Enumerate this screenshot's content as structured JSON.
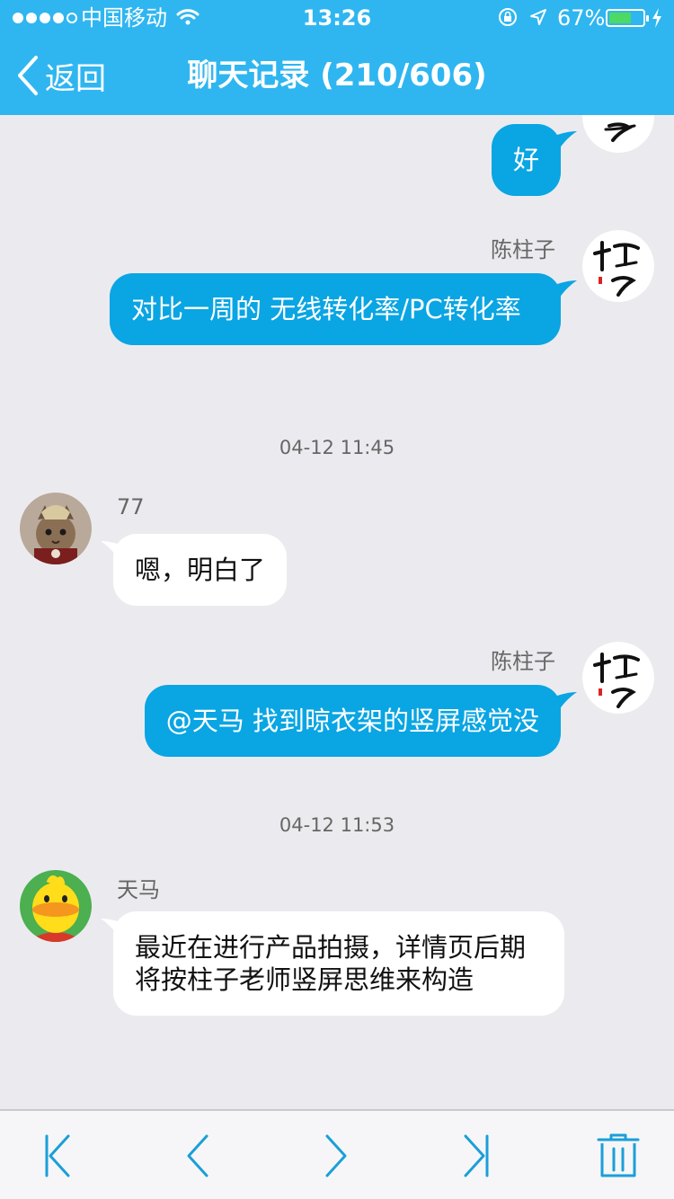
{
  "status_bar": {
    "carrier": "中国移动",
    "time": "13:26",
    "battery_percent": "67%",
    "battery_level": 0.67,
    "signal_bars_filled": 4,
    "signal_bars_total": 5
  },
  "nav": {
    "back_label": "返回",
    "title": "聊天记录 (210/606)"
  },
  "messages": [
    {
      "direction": "out",
      "sender": "",
      "text": "好",
      "avatar_icon": "calligraphy-avatar-icon"
    },
    {
      "direction": "out",
      "sender": "陈柱子",
      "text": "对比一周的  无线转化率/PC转化率",
      "avatar_icon": "calligraphy-avatar-icon"
    },
    {
      "direction": "in",
      "sender": "77",
      "text": "嗯，明白了",
      "avatar_icon": "cat-warrior-avatar-icon"
    },
    {
      "direction": "out",
      "sender": "陈柱子",
      "text": "@天马 找到晾衣架的竖屏感觉没",
      "avatar_icon": "calligraphy-avatar-icon"
    },
    {
      "direction": "in",
      "sender": "天马",
      "text": "最近在进行产品拍摄，详情页后期将按柱子老师竖屏思维来构造",
      "avatar_icon": "yellow-duck-avatar-icon"
    }
  ],
  "timestamps": [
    "04-12 11:45",
    "04-12 11:53"
  ],
  "toolbar": {
    "icons": [
      "first-page-icon",
      "previous-icon",
      "next-icon",
      "last-page-icon",
      "trash-icon"
    ]
  },
  "colors": {
    "header_bg": "#2fb6f0",
    "outgoing_bubble": "#0aa5e3",
    "incoming_bubble": "#ffffff",
    "chat_bg": "#ebebef",
    "toolbar_icon": "#1a9fd8"
  }
}
